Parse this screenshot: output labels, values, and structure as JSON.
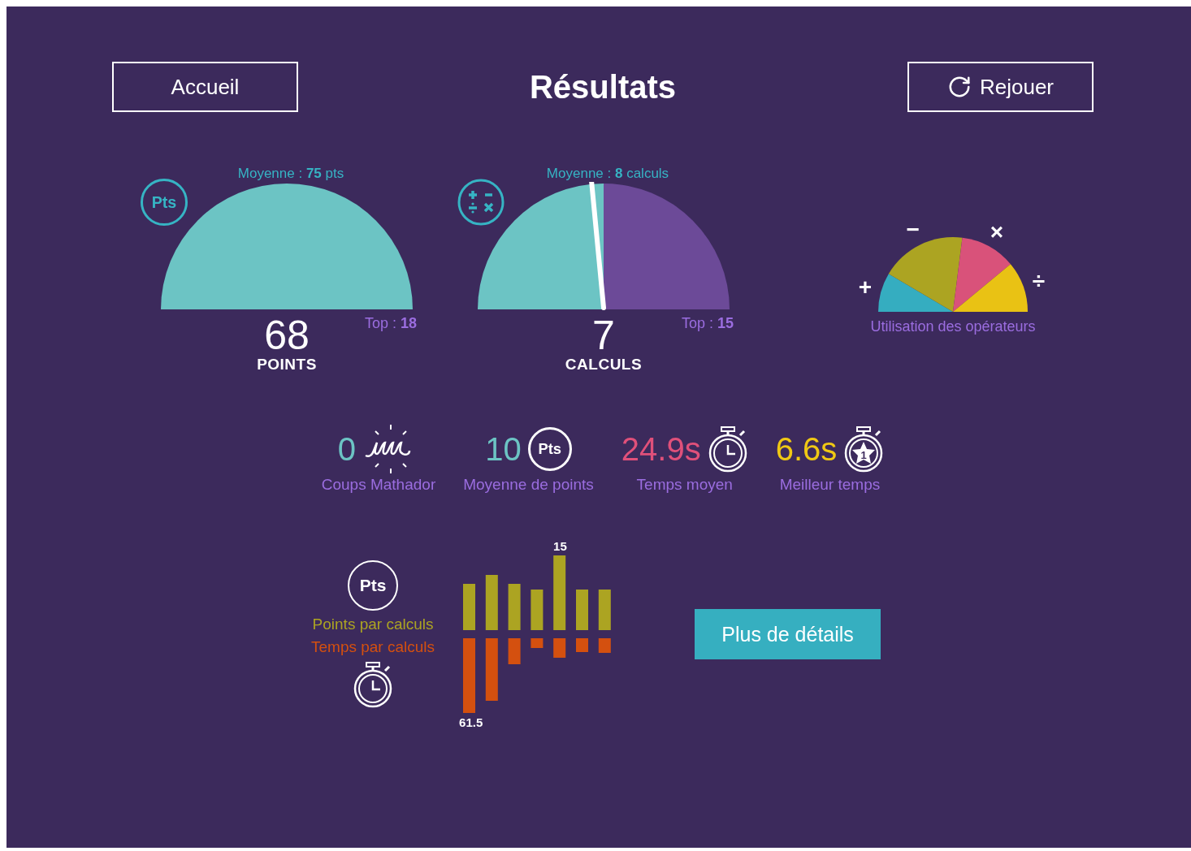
{
  "header": {
    "left_button": "Accueil",
    "title": "Résultats",
    "right_button": "Rejouer"
  },
  "gauges": [
    {
      "kind": "points",
      "badge": "Pts",
      "average_label": "Moyenne : ",
      "average_value": "75",
      "average_unit": " pts",
      "value": "68",
      "unit": "POINTS",
      "top_label": "Top : ",
      "top_value": "18"
    },
    {
      "kind": "calculs",
      "average_label": "Moyenne : ",
      "average_value": "8",
      "average_unit": " calculs",
      "value": "7",
      "unit": "CALCULS",
      "top_label": "Top : ",
      "top_value": "15"
    }
  ],
  "operators": {
    "title": "Utilisation des opérateurs",
    "items": [
      {
        "symbol": "+",
        "color": "#35adc0"
      },
      {
        "symbol": "−",
        "color": "#aca422"
      },
      {
        "symbol": "×",
        "color": "#d9527a"
      },
      {
        "symbol": "÷",
        "color": "#e9c214"
      }
    ]
  },
  "stats": [
    {
      "kind": "mathador",
      "value": "0",
      "label": "Coups Mathador",
      "color": "#6cc4c4"
    },
    {
      "kind": "points",
      "value": "10",
      "badge": "Pts",
      "label": "Moyenne de points",
      "color": "#6cc4c4"
    },
    {
      "kind": "time",
      "value": "24.9s",
      "label": "Temps moyen",
      "color": "#e0507a"
    },
    {
      "kind": "best",
      "value": "6.6s",
      "rank": "1",
      "label": "Meilleur temps",
      "color": "#f0c814"
    }
  ],
  "history": {
    "badge": "Pts",
    "points_legend": "Points par calculs",
    "time_legend": "Temps par calculs",
    "points_max_label": "15",
    "time_max_label": "61.5"
  },
  "details_button": "Plus de détails"
}
